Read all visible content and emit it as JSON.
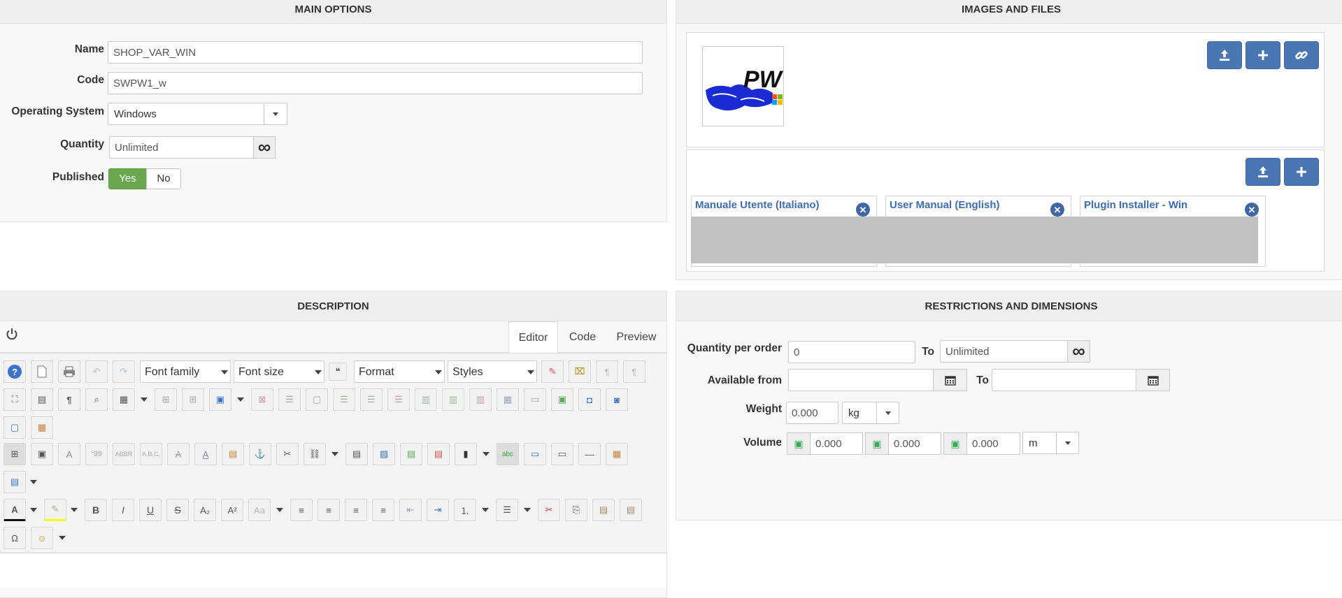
{
  "main_options": {
    "title": "MAIN OPTIONS",
    "name_label": "Name",
    "name_value": "SHOP_VAR_WIN",
    "code_label": "Code",
    "code_value": "SWPW1_w",
    "os_label": "Operating System",
    "os_value": "Windows",
    "quantity_label": "Quantity",
    "quantity_value": "Unlimited",
    "published_label": "Published",
    "published_yes": "Yes",
    "published_no": "No"
  },
  "images_files": {
    "title": "IMAGES AND FILES",
    "logo_text": "PW",
    "files": [
      {
        "name": "Manuale Utente (Italiano)"
      },
      {
        "name": "User Manual (English)"
      },
      {
        "name": "Plugin Installer - Win"
      }
    ]
  },
  "description": {
    "title": "DESCRIPTION",
    "tabs": [
      "Editor",
      "Code",
      "Preview"
    ],
    "active_tab": "Editor",
    "font_family": "Font family",
    "font_size": "Font size",
    "format": "Format",
    "styles": "Styles"
  },
  "restrictions": {
    "title": "RESTRICTIONS AND DIMENSIONS",
    "qty_per_order_label": "Quantity per order",
    "qty_from": "0",
    "to_label": "To",
    "qty_to": "Unlimited",
    "available_from_label": "Available from",
    "available_from": "",
    "available_to": "",
    "weight_label": "Weight",
    "weight_value": "0.000",
    "weight_unit": "kg",
    "volume_label": "Volume",
    "volume_values": [
      "0.000",
      "0.000",
      "0.000"
    ],
    "volume_unit": "m"
  },
  "colors": {
    "accent": "#4a76b3",
    "published_active": "#6aa84f",
    "link": "#3d6db3"
  }
}
